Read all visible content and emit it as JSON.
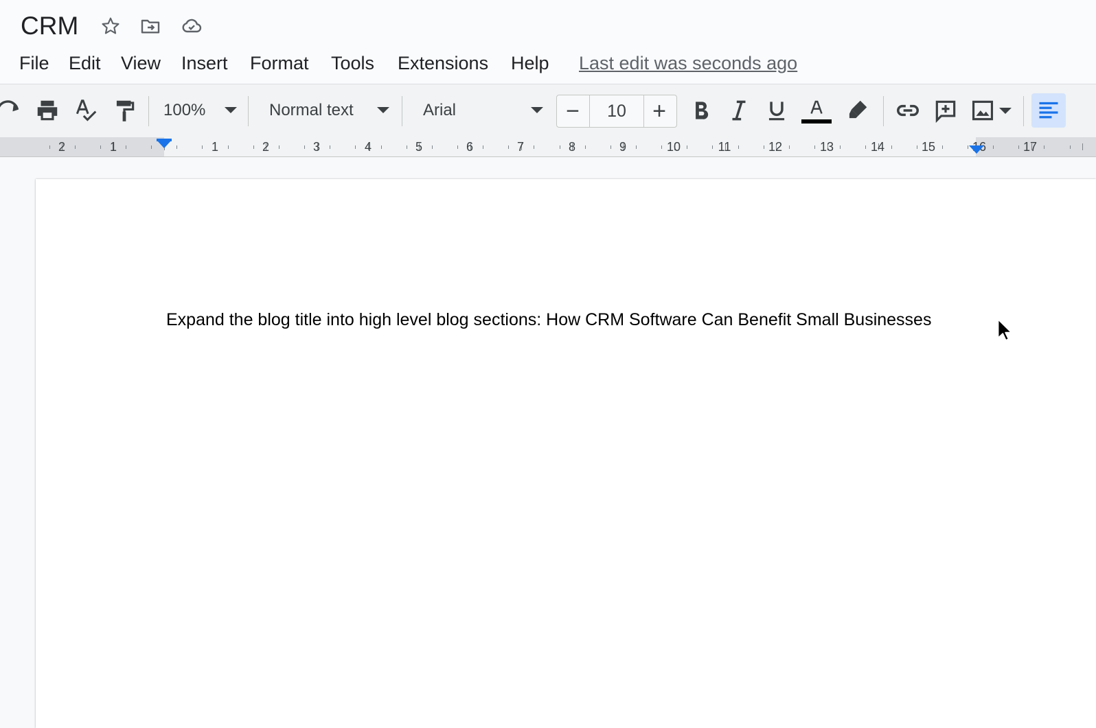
{
  "document": {
    "title": "CRM"
  },
  "title_icons": {
    "star": "star-icon",
    "move": "move-to-folder-icon",
    "cloud": "cloud-saved-icon"
  },
  "menu": {
    "items": [
      "File",
      "Edit",
      "View",
      "Insert",
      "Format",
      "Tools",
      "Extensions",
      "Help"
    ],
    "last_edit": "Last edit was seconds ago"
  },
  "toolbar": {
    "zoom": "100%",
    "style": "Normal text",
    "font": "Arial",
    "font_size": "10",
    "minus": "−",
    "plus": "+",
    "text_color": "#000000",
    "align_active_color": "#1a73e8"
  },
  "ruler": {
    "labels": [
      "2",
      "1",
      "1",
      "2",
      "3",
      "4",
      "5",
      "6",
      "7",
      "8",
      "9",
      "10",
      "11",
      "12",
      "13",
      "14",
      "15",
      "16",
      "17"
    ]
  },
  "page": {
    "body_text": "Expand the blog title into high level blog sections: How CRM Software Can Benefit Small Businesses"
  }
}
